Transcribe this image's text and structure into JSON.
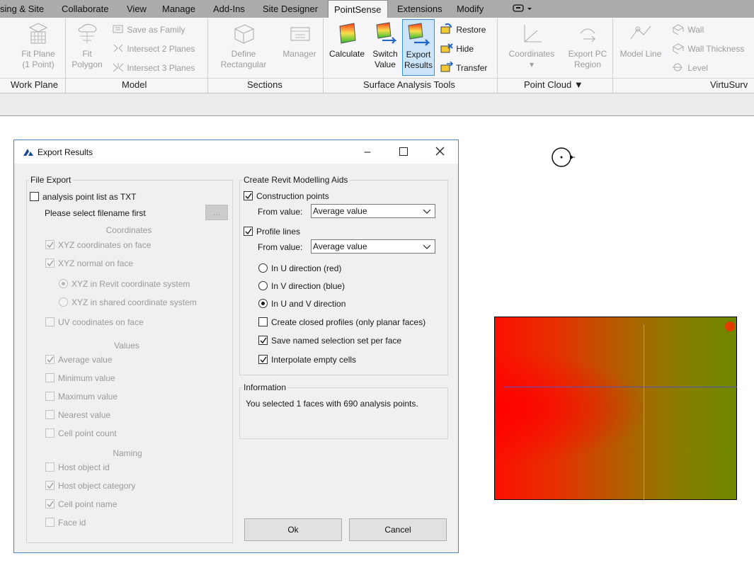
{
  "ribbon": {
    "tabs": [
      {
        "label": "sing & Site"
      },
      {
        "label": "Collaborate"
      },
      {
        "label": "View"
      },
      {
        "label": "Manage"
      },
      {
        "label": "Add-Ins"
      },
      {
        "label": "Site Designer"
      },
      {
        "label": "PointSense",
        "active": true
      },
      {
        "label": "Extensions"
      },
      {
        "label": "Modify"
      }
    ],
    "buttons": {
      "fit_plane": "Fit Plane",
      "fit_plane_sub": "(1 Point)",
      "fit": "Fit",
      "polygon": "Polygon",
      "save_as_family": "Save as Family",
      "intersect_2": "Intersect 2 Planes",
      "intersect_3": "Intersect 3 Planes",
      "define": "Define",
      "rectangular": "Rectangular",
      "manager": "Manager",
      "calculate": "Calculate",
      "switch": "Switch",
      "value": "Value",
      "export": "Export",
      "results": "Results",
      "restore": "Restore",
      "hide": "Hide",
      "transfer": "Transfer",
      "coordinates": "Coordinates",
      "export_pc": "Export PC",
      "region": "Region",
      "model_line": "Model Line",
      "wall": "Wall",
      "wall_thickness": "Wall Thickness",
      "level": "Level"
    },
    "panels": {
      "work_plane": "Work Plane",
      "model": "Model",
      "sections": "Sections",
      "surface_analysis": "Surface Analysis Tools",
      "point_cloud": "Point Cloud",
      "virtusurv": "VirtuSurv"
    }
  },
  "dialog": {
    "title": "Export Results",
    "file_export": {
      "legend": "File Export",
      "txt_option": {
        "label": "analysis point list as TXT",
        "checked": false
      },
      "filename_hint": "Please select filename first",
      "browse_label": "...",
      "coordinates_caption": "Coordinates",
      "xyz_coords": {
        "label": "XYZ coordinates on face",
        "checked": true
      },
      "xyz_normal": {
        "label": "XYZ normal on face",
        "checked": true
      },
      "revit_cs": {
        "label": "XYZ in Revit coordinate system",
        "selected": true
      },
      "shared_cs": {
        "label": "XYZ in shared coordinate system",
        "selected": false
      },
      "uv_coords": {
        "label": "UV coodinates on face",
        "checked": false
      },
      "values_caption": "Values",
      "average": {
        "label": "Average value",
        "checked": true
      },
      "minimum": {
        "label": "Minimum value",
        "checked": false
      },
      "maximum": {
        "label": "Maximum value",
        "checked": false
      },
      "nearest": {
        "label": "Nearest value",
        "checked": false
      },
      "cell_count": {
        "label": "Cell point count",
        "checked": false
      },
      "naming_caption": "Naming",
      "host_id": {
        "label": "Host object id",
        "checked": false
      },
      "host_category": {
        "label": "Host object category",
        "checked": true
      },
      "cell_name": {
        "label": "Cell point name",
        "checked": true
      },
      "face_id": {
        "label": "Face id",
        "checked": false
      }
    },
    "modelling_aids": {
      "legend": "Create Revit Modelling Aids",
      "construction_points": {
        "label": "Construction points",
        "checked": true
      },
      "from_value_label_1": "From value:",
      "from_value_1": "Average value",
      "profile_lines": {
        "label": "Profile lines",
        "checked": true
      },
      "from_value_label_2": "From value:",
      "from_value_2": "Average value",
      "u_dir": {
        "label": "In U direction (red)",
        "selected": false
      },
      "v_dir": {
        "label": "In V direction (blue)",
        "selected": false
      },
      "uv_dir": {
        "label": "In U and V direction",
        "selected": true
      },
      "closed_profiles": {
        "label": "Create closed profiles (only planar faces)",
        "checked": false
      },
      "named_selection": {
        "label": "Save named selection set per face",
        "checked": true
      },
      "interpolate": {
        "label": "Interpolate empty cells",
        "checked": true
      }
    },
    "information": {
      "legend": "Information",
      "text": "You selected 1 faces with 690 analysis points."
    },
    "ok_label": "Ok",
    "cancel_label": "Cancel"
  },
  "colors": {
    "active_button_bg": "#cce4f7",
    "heatmap_left": "#fb1000",
    "heatmap_right": "#6f8800"
  }
}
